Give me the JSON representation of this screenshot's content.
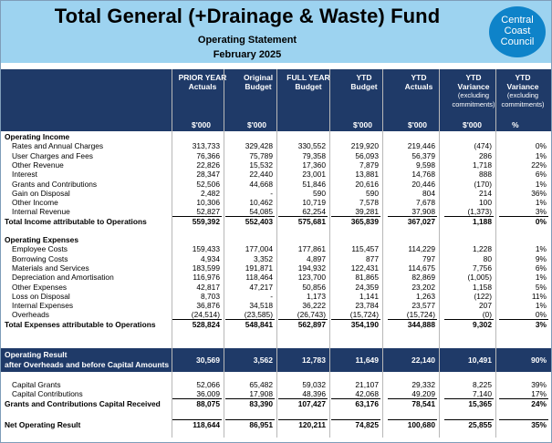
{
  "header": {
    "title": "Total General (+Drainage & Waste) Fund",
    "subtitle": "Operating Statement",
    "period": "February 2025",
    "logo": [
      "Central",
      "Coast",
      "Council"
    ]
  },
  "columns": [
    {
      "label": "PRIOR YEAR\nActuals",
      "sub": "",
      "unit": "$'000"
    },
    {
      "label": "Original\nBudget",
      "sub": "",
      "unit": "$'000"
    },
    {
      "label": "FULL YEAR\nBudget",
      "sub": "",
      "unit": ""
    },
    {
      "label": "YTD\nBudget",
      "sub": "",
      "unit": "$'000"
    },
    {
      "label": "YTD\nActuals",
      "sub": "",
      "unit": "$'000"
    },
    {
      "label": "YTD\nVariance",
      "sub": "(excluding\ncommitments)",
      "unit": "$'000"
    },
    {
      "label": "YTD\nVariance",
      "sub": "(excluding\ncommitments)",
      "unit": "%"
    }
  ],
  "rows": [
    {
      "type": "section",
      "label": "Operating Income"
    },
    {
      "type": "item",
      "label": "Rates and Annual Charges",
      "v": [
        "313,733",
        "329,428",
        "330,552",
        "219,920",
        "219,446",
        "(474)",
        "0%"
      ]
    },
    {
      "type": "item",
      "label": "User Charges and Fees",
      "v": [
        "76,366",
        "75,789",
        "79,358",
        "56,093",
        "56,379",
        "286",
        "1%"
      ]
    },
    {
      "type": "item",
      "label": "Other Revenue",
      "v": [
        "22,826",
        "15,532",
        "17,360",
        "7,879",
        "9,598",
        "1,718",
        "22%"
      ]
    },
    {
      "type": "item",
      "label": "Interest",
      "v": [
        "28,347",
        "22,440",
        "23,001",
        "13,881",
        "14,768",
        "888",
        "6%"
      ]
    },
    {
      "type": "item",
      "label": "Grants and Contributions",
      "v": [
        "52,506",
        "44,668",
        "51,846",
        "20,616",
        "20,446",
        "(170)",
        "1%"
      ]
    },
    {
      "type": "item",
      "label": "Gain on Disposal",
      "v": [
        "2,482",
        "-",
        "590",
        "590",
        "804",
        "214",
        "36%"
      ]
    },
    {
      "type": "item",
      "label": "Other Income",
      "v": [
        "10,306",
        "10,462",
        "10,719",
        "7,578",
        "7,678",
        "100",
        "1%"
      ]
    },
    {
      "type": "item",
      "label": "Internal Revenue",
      "v": [
        "52,827",
        "54,085",
        "62,254",
        "39,281",
        "37,908",
        "(1,373)",
        "3%"
      ]
    },
    {
      "type": "total",
      "label": "Total Income attributable to Operations",
      "v": [
        "559,392",
        "552,403",
        "575,681",
        "365,839",
        "367,027",
        "1,188",
        "0%"
      ]
    },
    {
      "type": "gap"
    },
    {
      "type": "section",
      "label": "Operating Expenses"
    },
    {
      "type": "item",
      "label": "Employee Costs",
      "v": [
        "159,433",
        "177,004",
        "177,861",
        "115,457",
        "114,229",
        "1,228",
        "1%"
      ]
    },
    {
      "type": "item",
      "label": "Borrowing Costs",
      "v": [
        "4,934",
        "3,352",
        "4,897",
        "877",
        "797",
        "80",
        "9%"
      ]
    },
    {
      "type": "item",
      "label": "Materials and Services",
      "v": [
        "183,599",
        "191,871",
        "194,932",
        "122,431",
        "114,675",
        "7,756",
        "6%"
      ]
    },
    {
      "type": "item",
      "label": "Depreciation and Amortisation",
      "v": [
        "116,976",
        "118,464",
        "123,700",
        "81,865",
        "82,869",
        "(1,005)",
        "1%"
      ]
    },
    {
      "type": "item",
      "label": "Other Expenses",
      "v": [
        "42,817",
        "47,217",
        "50,856",
        "24,359",
        "23,202",
        "1,158",
        "5%"
      ]
    },
    {
      "type": "item",
      "label": "Loss on Disposal",
      "v": [
        "8,703",
        "-",
        "1,173",
        "1,141",
        "1,263",
        "(122)",
        "11%"
      ]
    },
    {
      "type": "item",
      "label": "Internal Expenses",
      "v": [
        "36,876",
        "34,518",
        "36,222",
        "23,784",
        "23,577",
        "207",
        "1%"
      ]
    },
    {
      "type": "item",
      "label": "Overheads",
      "v": [
        "(24,514)",
        "(23,585)",
        "(26,743)",
        "(15,724)",
        "(15,724)",
        "(0)",
        "0%"
      ]
    },
    {
      "type": "total",
      "label": "Total Expenses attributable to Operations",
      "v": [
        "528,824",
        "548,841",
        "562,897",
        "354,190",
        "344,888",
        "9,302",
        "3%"
      ]
    }
  ],
  "operating_result": {
    "label1": "Operating Result",
    "label2": "after Overheads and before Capital Amounts",
    "v": [
      "30,569",
      "3,562",
      "12,783",
      "11,649",
      "22,140",
      "10,491",
      "90%"
    ]
  },
  "capital_rows": [
    {
      "type": "item",
      "label": "Capital Grants",
      "v": [
        "52,066",
        "65,482",
        "59,032",
        "21,107",
        "29,332",
        "8,225",
        "39%"
      ]
    },
    {
      "type": "item",
      "label": "Capital Contributions",
      "v": [
        "36,009",
        "17,908",
        "48,396",
        "42,068",
        "49,209",
        "7,140",
        "17%"
      ]
    },
    {
      "type": "total",
      "label": "Grants and Contributions Capital Received",
      "v": [
        "88,075",
        "83,390",
        "107,427",
        "63,176",
        "78,541",
        "15,365",
        "24%"
      ]
    }
  ],
  "net_result": {
    "label": "Net Operating Result",
    "v": [
      "118,644",
      "86,951",
      "120,211",
      "74,825",
      "100,680",
      "25,855",
      "35%"
    ]
  },
  "colors": {
    "header_bg": "#9dd3f0",
    "table_head": "#1f3a68",
    "logo": "#0e83c9"
  }
}
